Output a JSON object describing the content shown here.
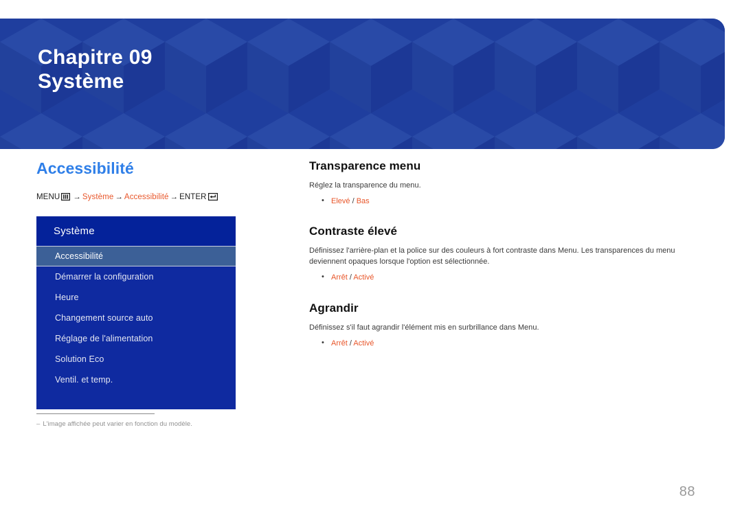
{
  "banner": {
    "chapter_label": "Chapitre 09",
    "chapter_title": "Système",
    "background_color": "#1f3f9e"
  },
  "left": {
    "section_title": "Accessibilité",
    "accent_color": "#2f7fe8",
    "breadcrumb": {
      "menu_label": "MENU",
      "menu_icon": "menu-grid-icon",
      "arrow": "→",
      "path_1": "Système",
      "path_2": "Accessibilité",
      "enter_label": "ENTER",
      "enter_icon": "enter-key-icon",
      "highlight_color": "#e8562a"
    },
    "osd": {
      "header": "Système",
      "header_color": "#04229a",
      "body_color": "#0f2aa0",
      "selected_color": "#3c6097",
      "items": [
        {
          "label": "Accessibilité",
          "selected": true
        },
        {
          "label": "Démarrer la configuration",
          "selected": false
        },
        {
          "label": "Heure",
          "selected": false
        },
        {
          "label": "Changement source auto",
          "selected": false
        },
        {
          "label": "Réglage de l'alimentation",
          "selected": false
        },
        {
          "label": "Solution Eco",
          "selected": false
        },
        {
          "label": "Ventil. et temp.",
          "selected": false
        }
      ]
    },
    "footnote": {
      "dash": "–",
      "text": "L'image affichée peut varier en fonction du modèle."
    }
  },
  "right": {
    "topics": [
      {
        "title": "Transparence menu",
        "desc": "Réglez la transparence du menu.",
        "options": [
          {
            "first": "Elevé",
            "sep": " / ",
            "second": "Bas"
          }
        ]
      },
      {
        "title": "Contraste élevé",
        "desc": "Définissez l'arrière-plan et la police sur des couleurs à fort contraste dans Menu. Les transparences du menu deviennent opaques lorsque l'option est sélectionnée.",
        "options": [
          {
            "first": "Arrêt",
            "sep": " / ",
            "second": "Activé"
          }
        ]
      },
      {
        "title": "Agrandir",
        "desc": "Définissez s'il faut agrandir l'élément mis en surbrillance dans Menu.",
        "options": [
          {
            "first": "Arrêt",
            "sep": " / ",
            "second": "Activé"
          }
        ]
      }
    ]
  },
  "page_number": "88"
}
